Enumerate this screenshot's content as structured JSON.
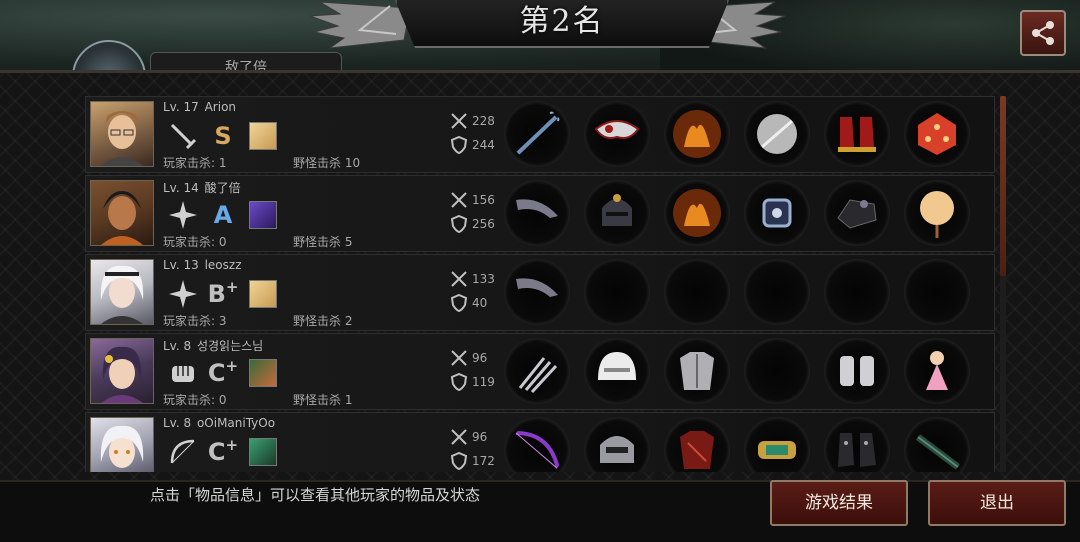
{
  "header": {
    "title": "第2名",
    "rank_tab_label": "敌了倍"
  },
  "players": [
    {
      "level": "Lv. 17",
      "name": "Arion",
      "weapon_icon": "sword-icon",
      "grade": "S",
      "grade_sup": "",
      "player_kills": "玩家击杀: 1",
      "monster_kills": "野怪击杀 10",
      "attack": "228",
      "defense": "244",
      "items": [
        "trident",
        "mask",
        "flame-armor",
        "disc",
        "red-boots",
        "red-dice"
      ]
    },
    {
      "level": "Lv. 14",
      "name": "酸了倍",
      "weapon_icon": "shuriken-icon",
      "grade": "A",
      "grade_sup": "",
      "player_kills": "玩家击杀: 0",
      "monster_kills": "野怪击杀 5",
      "attack": "156",
      "defense": "256",
      "items": [
        "boomerang",
        "knight-helmet",
        "flame-armor",
        "bracelet",
        "black-gauntlet",
        "lollipop"
      ]
    },
    {
      "level": "Lv. 13",
      "name": "leoszz",
      "weapon_icon": "shuriken-icon",
      "grade": "B",
      "grade_sup": "+",
      "player_kills": "玩家击杀: 3",
      "monster_kills": "野怪击杀 2",
      "attack": "133",
      "defense": "40",
      "items": [
        "boomerang",
        "",
        "",
        "",
        "",
        ""
      ]
    },
    {
      "level": "Lv. 8",
      "name": "성경읽는스님",
      "weapon_icon": "fist-icon",
      "grade": "C",
      "grade_sup": "+",
      "player_kills": "玩家击杀: 0",
      "monster_kills": "野怪击杀 1",
      "attack": "96",
      "defense": "119",
      "items": [
        "claw",
        "white-helmet",
        "plate-armor",
        "",
        "gauntlet",
        "doll"
      ]
    },
    {
      "level": "Lv. 8",
      "name": "oOiManiTyOo",
      "weapon_icon": "bow-icon",
      "grade": "C",
      "grade_sup": "+",
      "player_kills": "",
      "monster_kills": "",
      "attack": "96",
      "defense": "172",
      "items": [
        "purple-bow",
        "steel-helmet",
        "red-armor",
        "gold-bracer",
        "dark-boots",
        "spyglass"
      ]
    }
  ],
  "footer": {
    "hint": "点击「物品信息」可以查看其他玩家的物品及状态",
    "result_button": "游戏结果",
    "exit_button": "退出"
  },
  "colors": {
    "grade_s": "#d8a760",
    "grade_a": "#6aa8e8",
    "button_red": "#5a1c16"
  }
}
